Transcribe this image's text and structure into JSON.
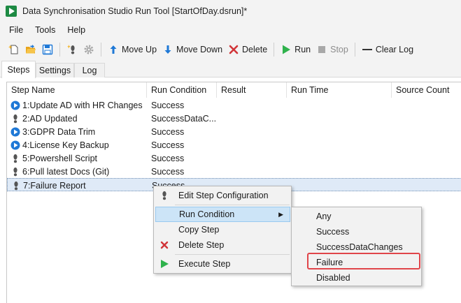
{
  "window": {
    "title": "Data Synchronisation Studio Run Tool [StartOfDay.dsrun]*"
  },
  "menubar": {
    "items": [
      "File",
      "Tools",
      "Help"
    ]
  },
  "toolbar": {
    "move_up": "Move Up",
    "move_down": "Move Down",
    "delete": "Delete",
    "run": "Run",
    "stop": "Stop",
    "clear_log": "Clear Log"
  },
  "tabs": [
    "Steps",
    "Settings",
    "Log"
  ],
  "columns": [
    "Step Name",
    "Run Condition",
    "Result",
    "Run Time",
    "Source Count"
  ],
  "rows": [
    {
      "name": "1:Update AD with HR Changes",
      "condition": "Success",
      "icon": "play-icon"
    },
    {
      "name": "2:AD Updated",
      "condition": "SuccessDataC...",
      "icon": "powershell-foot-icon"
    },
    {
      "name": "3:GDPR Data Trim",
      "condition": "Success",
      "icon": "play-icon"
    },
    {
      "name": "4:License Key Backup",
      "condition": "Success",
      "icon": "play-icon"
    },
    {
      "name": "5:Powershell Script",
      "condition": "Success",
      "icon": "powershell-foot-icon"
    },
    {
      "name": "6:Pull latest Docs (Git)",
      "condition": "Success",
      "icon": "powershell-foot-icon"
    },
    {
      "name": "7:Failure Report",
      "condition": "Success",
      "icon": "powershell-foot-icon"
    }
  ],
  "context_menu": {
    "edit": "Edit Step Configuration",
    "run_condition": "Run Condition",
    "copy": "Copy Step",
    "delete": "Delete Step",
    "execute": "Execute Step"
  },
  "run_condition_submenu": [
    "Any",
    "Success",
    "SuccessDataChanges",
    "Failure",
    "Disabled"
  ],
  "colors": {
    "accent_blue": "#1e78d6",
    "run_green": "#2fb24c",
    "delete_red": "#d13438",
    "highlight_red": "#e0454a",
    "selection": "#dfeaf7"
  }
}
